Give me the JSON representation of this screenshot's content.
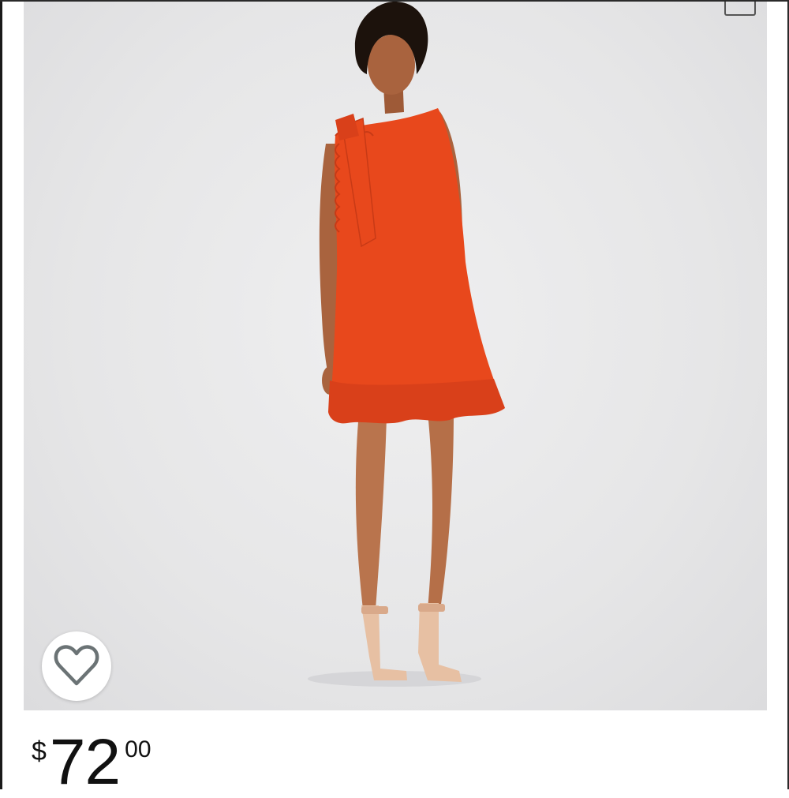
{
  "product": {
    "image_icon": "product-photo",
    "colors": {
      "dress": "#e8481c",
      "background": "#e8e8e9"
    }
  },
  "like": {
    "icon": "heart-outline-icon",
    "color": "#6b7375"
  },
  "price": {
    "currency": "$",
    "dollars": "72",
    "cents": "00"
  },
  "corner_icon": "checkbox-icon"
}
